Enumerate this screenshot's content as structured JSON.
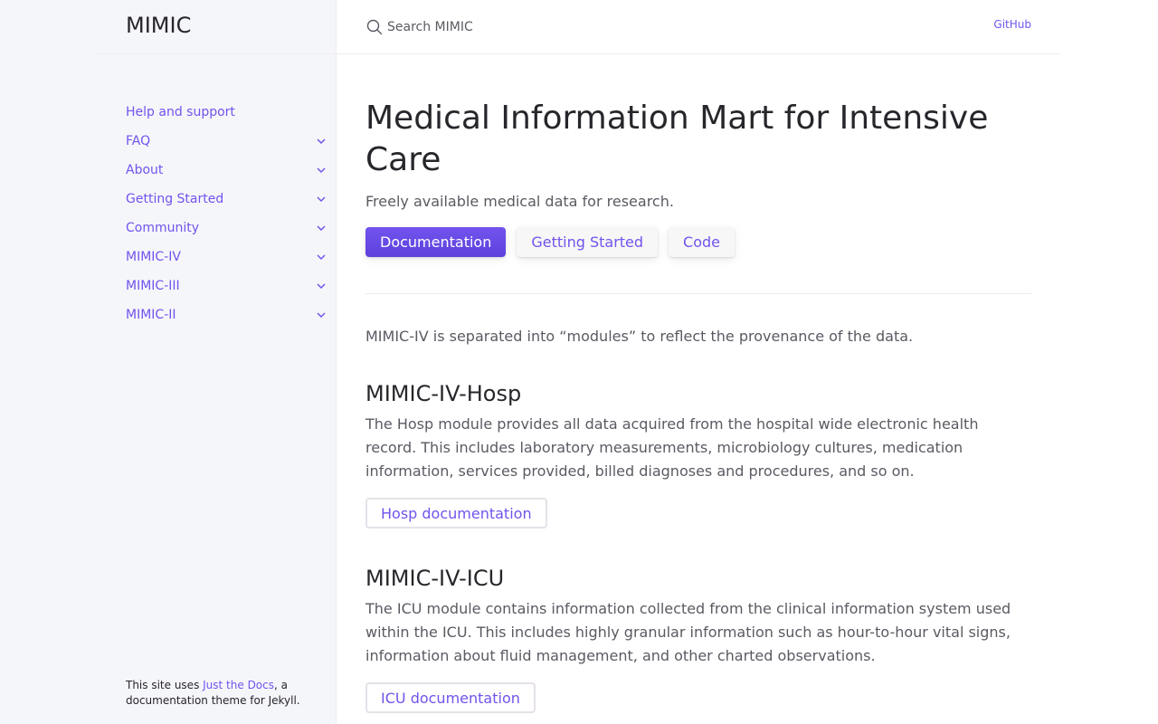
{
  "site": {
    "title": "MIMIC"
  },
  "search": {
    "placeholder": "Search MIMIC"
  },
  "header": {
    "github_label": "GitHub"
  },
  "sidebar": {
    "items": [
      {
        "label": "Help and support",
        "expandable": false
      },
      {
        "label": "FAQ",
        "expandable": true
      },
      {
        "label": "About",
        "expandable": true
      },
      {
        "label": "Getting Started",
        "expandable": true
      },
      {
        "label": "Community",
        "expandable": true
      },
      {
        "label": "MIMIC-IV",
        "expandable": true
      },
      {
        "label": "MIMIC-III",
        "expandable": true
      },
      {
        "label": "MIMIC-II",
        "expandable": true
      }
    ],
    "footer": {
      "prefix": "This site uses ",
      "link": "Just the Docs",
      "suffix": ", a documentation theme for Jekyll."
    }
  },
  "main": {
    "title": "Medical Information Mart for Intensive Care",
    "lead": "Freely available medical data for research.",
    "buttons": {
      "documentation": "Documentation",
      "getting_started": "Getting Started",
      "code": "Code"
    },
    "intro": "MIMIC-IV is separated into “modules” to reflect the provenance of the data.",
    "sections": [
      {
        "heading": "MIMIC-IV-Hosp",
        "body": "The Hosp module provides all data acquired from the hospital wide electronic health record. This includes laboratory measurements, microbiology cultures, medication information, services provided, billed diagnoses and procedures, and so on.",
        "button": "Hosp documentation"
      },
      {
        "heading": "MIMIC-IV-ICU",
        "body": "The ICU module contains information collected from the clinical information system used within the ICU. This includes highly granular information such as hour-to-hour vital signs, information about fluid management, and other charted observations.",
        "button": "ICU documentation"
      }
    ]
  },
  "colors": {
    "accent": "#7253ed",
    "text": "#5c5962",
    "heading": "#27262b",
    "sidebar_bg": "#f5f6fa"
  }
}
